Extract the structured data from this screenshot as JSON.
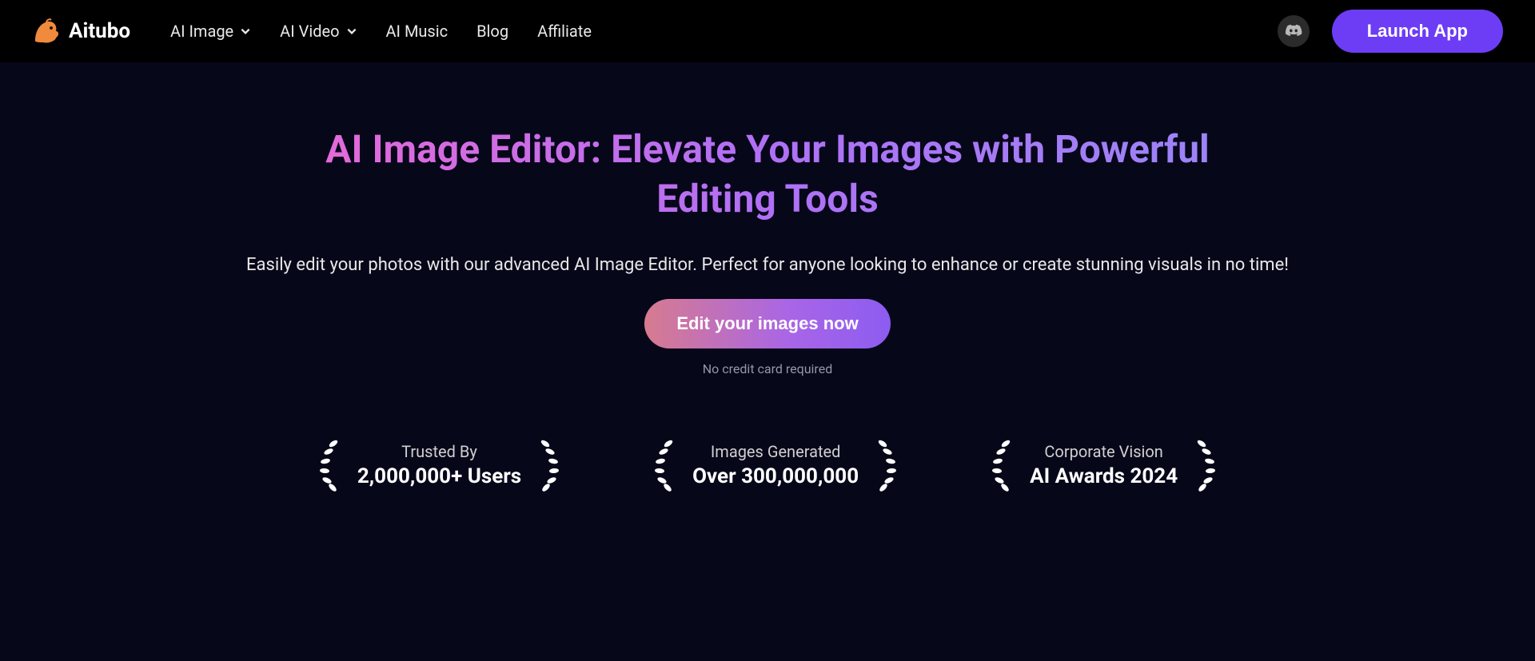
{
  "brand": {
    "name": "Aitubo"
  },
  "nav": {
    "items": [
      {
        "label": "AI Image",
        "hasDropdown": true
      },
      {
        "label": "AI Video",
        "hasDropdown": true
      },
      {
        "label": "AI Music",
        "hasDropdown": false
      },
      {
        "label": "Blog",
        "hasDropdown": false
      },
      {
        "label": "Affiliate",
        "hasDropdown": false
      }
    ]
  },
  "header": {
    "launchLabel": "Launch App"
  },
  "hero": {
    "title": "AI Image Editor: Elevate Your Images with Powerful Editing Tools",
    "subtitle": "Easily edit your photos with our advanced AI Image Editor. Perfect for anyone looking to enhance or create stunning visuals in no time!",
    "ctaLabel": "Edit your images now",
    "ctaNote": "No credit card required"
  },
  "awards": [
    {
      "label": "Trusted By",
      "value": "2,000,000+ Users"
    },
    {
      "label": "Images Generated",
      "value": "Over 300,000,000"
    },
    {
      "label": "Corporate Vision",
      "value": "AI Awards 2024"
    }
  ]
}
